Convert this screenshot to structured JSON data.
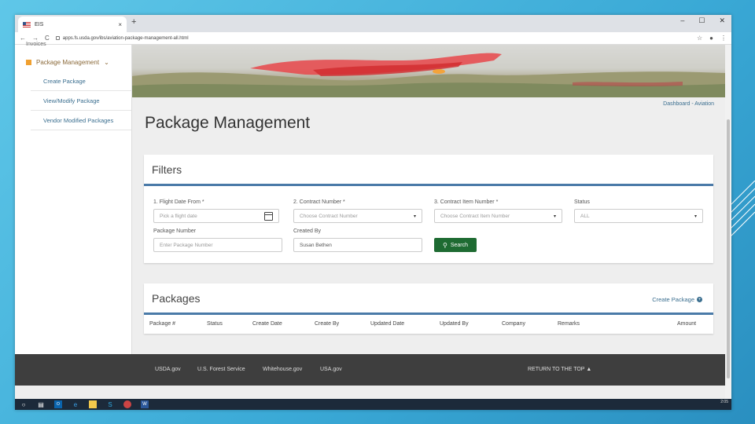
{
  "browser": {
    "tab_title": "EIS",
    "tab_close": "×",
    "new_tab": "+",
    "win_minimize": "–",
    "win_maximize": "☐",
    "win_close": "✕",
    "url": "apps.fs.usda.gov/ibs/aviation-package-management-all.html",
    "back": "←",
    "forward": "→",
    "reload": "C",
    "star": "☆",
    "profile": "●",
    "menu": "⋮"
  },
  "sidebar": {
    "prev_item": "Invoices",
    "group_label": "Package Management",
    "group_chevron": "⌄",
    "items": [
      {
        "label": "Create Package"
      },
      {
        "label": "View/Modify Package"
      },
      {
        "label": "Vendor Modified Packages"
      }
    ]
  },
  "breadcrumb": "Dashboard - Aviation",
  "page_title": "Package Management",
  "filters": {
    "title": "Filters",
    "flight_date": {
      "label": "1. Flight Date From *",
      "placeholder": "Pick a flight date"
    },
    "contract_number": {
      "label": "2. Contract Number *",
      "placeholder": "Choose Contract Number"
    },
    "contract_item": {
      "label": "3. Contract Item Number *",
      "placeholder": "Choose Contract Item Number"
    },
    "status": {
      "label": "Status",
      "value": "ALL"
    },
    "package_number": {
      "label": "Package Number",
      "placeholder": "Enter Package Number"
    },
    "created_by": {
      "label": "Created By",
      "value": "Susan Bethen"
    },
    "search_label": "Search",
    "caret": "▾"
  },
  "packages": {
    "title": "Packages",
    "create_link": "Create Package",
    "columns": [
      "Package #",
      "Status",
      "Create Date",
      "Create By",
      "Updated Date",
      "Updated By",
      "Company",
      "Remarks",
      "Amount"
    ]
  },
  "footer": {
    "links": [
      "USDA.gov",
      "U.S. Forest Service",
      "Whitehouse.gov",
      "USA.gov"
    ],
    "return_top": "RETURN TO THE TOP"
  },
  "taskbar": {
    "clock": "2:05"
  },
  "colors": {
    "primary_green": "#1e6b32",
    "accent_blue": "#4a7aa8",
    "link_blue": "#3a6e8f",
    "footer_bg": "#3e3e3e"
  }
}
